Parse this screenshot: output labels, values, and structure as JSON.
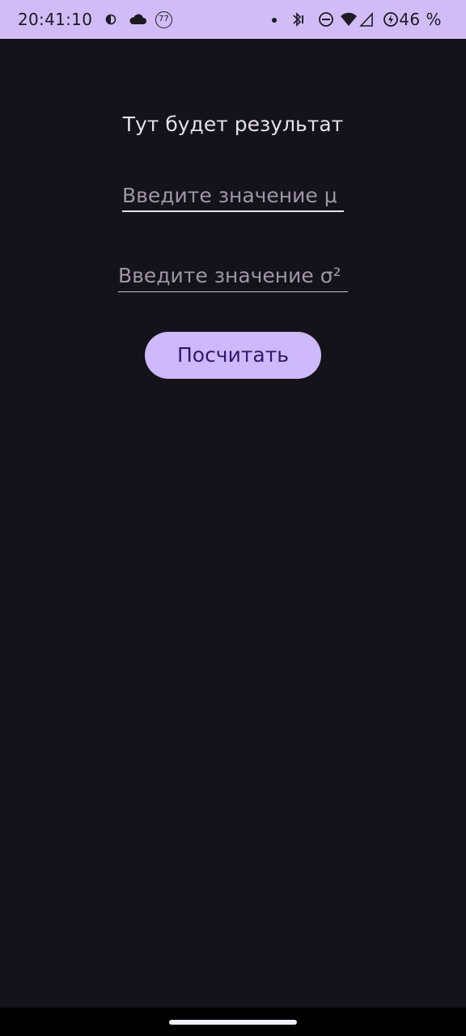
{
  "status_bar": {
    "time": "20:41:10",
    "notification_badge": "77",
    "battery_percent": "46 %",
    "background_color": "#d1bcf8",
    "icons": [
      "data-saver-icon",
      "cloud-icon",
      "notification-badge-icon",
      "dot-icon",
      "bluetooth-icon",
      "do-not-disturb-icon",
      "wifi-icon",
      "cellular-signal-icon",
      "battery-saver-icon"
    ]
  },
  "main": {
    "result_text": "Тут будет результат",
    "mu_input": {
      "placeholder": "Введите значение μ",
      "value": ""
    },
    "sigma_input": {
      "placeholder": "Введите значение σ²",
      "value": ""
    },
    "calculate_button_label": "Посчитать"
  },
  "colors": {
    "background": "#14121b",
    "accent": "#cdb9fb",
    "button_text": "#33176b",
    "text": "#e6e0ec"
  }
}
